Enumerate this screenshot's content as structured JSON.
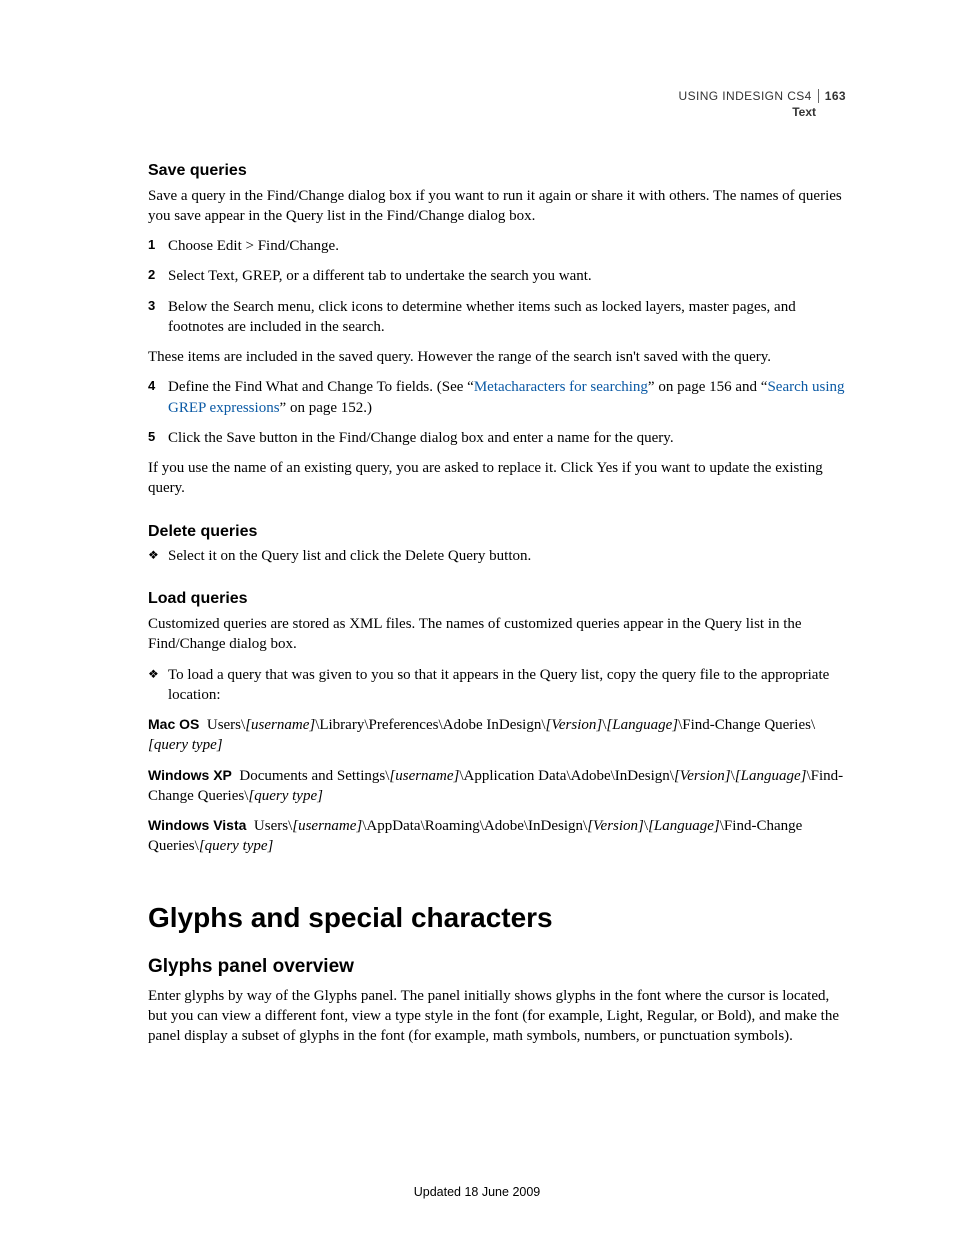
{
  "header": {
    "product": "USING INDESIGN CS4",
    "section": "Text",
    "page_number": "163"
  },
  "save_queries": {
    "heading": "Save queries",
    "intro": "Save a query in the Find/Change dialog box if you want to run it again or share it with others. The names of queries you save appear in the Query list in the Find/Change dialog box.",
    "step1": "Choose Edit > Find/Change.",
    "step2": "Select Text, GREP, or a different tab to undertake the search you want.",
    "step3": "Below the Search menu, click icons to determine whether items such as locked layers, master pages, and footnotes are included in the search.",
    "note_after3": "These items are included in the saved query. However the range of the search isn't saved with the query.",
    "step4_pre": "Define the Find What and Change To fields. (See “",
    "step4_link1": "Metacharacters for searching",
    "step4_mid": "” on page 156 and “",
    "step4_link2": "Search using GREP expressions",
    "step4_post": "” on page 152.)",
    "step5": "Click the Save button in the Find/Change dialog box and enter a name for the query.",
    "closing": "If you use the name of an existing query, you are asked to replace it. Click Yes if you want to update the existing query."
  },
  "delete_queries": {
    "heading": "Delete queries",
    "bullet": "Select it on the Query list and click the Delete Query button."
  },
  "load_queries": {
    "heading": "Load queries",
    "intro": "Customized queries are stored as XML files. The names of customized queries appear in the Query list in the Find/Change dialog box.",
    "bullet": "To load a query that was given to you so that it appears in the Query list, copy the query file to the appropriate location:",
    "macos_label": "Mac OS",
    "winxp_label": "Windows XP",
    "winvista_label": "Windows Vista"
  },
  "glyphs": {
    "title": "Glyphs and special characters",
    "subhead": "Glyphs panel overview",
    "para": "Enter glyphs by way of the Glyphs panel. The panel initially shows glyphs in the font where the cursor is located, but you can view a different font, view a type style in the font (for example, Light, Regular, or Bold), and make the panel display a subset of glyphs in the font (for example, math symbols, numbers, or punctuation symbols)."
  },
  "footer": {
    "updated": "Updated 18 June 2009"
  }
}
